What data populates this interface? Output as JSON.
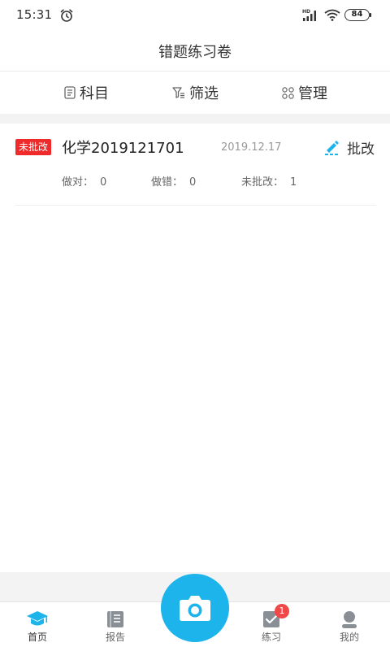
{
  "status_bar": {
    "time": "15:31",
    "battery": "84",
    "icons": [
      "alarm-icon",
      "signal-icon",
      "wifi-icon",
      "battery-icon"
    ]
  },
  "header": {
    "title": "错题练习卷"
  },
  "filters": [
    {
      "label": "科目",
      "icon": "subject-icon"
    },
    {
      "label": "筛选",
      "icon": "filter-icon"
    },
    {
      "label": "管理",
      "icon": "grid-icon"
    }
  ],
  "papers": [
    {
      "status": "未批改",
      "title": "化学2019121701",
      "date": "2019.12.17",
      "action_label": "批改",
      "stats": {
        "correct_label": "做对：",
        "correct_value": "0",
        "wrong_label": "做错：",
        "wrong_value": "0",
        "unmarked_label": "未批改：",
        "unmarked_value": "1"
      }
    }
  ],
  "bottom_nav": {
    "items": [
      {
        "label": "首页",
        "icon": "home-cap-icon",
        "active": true
      },
      {
        "label": "报告",
        "icon": "report-book-icon"
      },
      {
        "label": "练习",
        "icon": "practice-icon",
        "badge": "1"
      },
      {
        "label": "我的",
        "icon": "profile-icon"
      }
    ],
    "camera_icon": "camera-icon"
  },
  "colors": {
    "accent_blue": "#1cb4ea",
    "badge_red": "#ee2a2a",
    "text_primary": "#333333",
    "text_muted": "#999999",
    "bg_grey": "#f3f3f3"
  }
}
